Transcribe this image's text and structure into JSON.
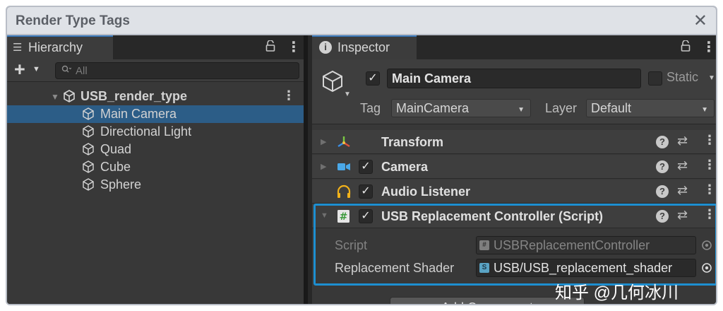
{
  "window": {
    "title": "Render Type Tags",
    "close_glyph": "✕"
  },
  "hierarchy": {
    "tab_label": "Hierarchy",
    "add_label": "+",
    "search_placeholder": "All",
    "scene": {
      "name": "USB_render_type"
    },
    "items": [
      {
        "label": "Main Camera",
        "selected": true
      },
      {
        "label": "Directional Light",
        "selected": false
      },
      {
        "label": "Quad",
        "selected": false
      },
      {
        "label": "Cube",
        "selected": false
      },
      {
        "label": "Sphere",
        "selected": false
      }
    ]
  },
  "inspector": {
    "tab_label": "Inspector",
    "gameobject": {
      "active": true,
      "name": "Main Camera",
      "static_label": "Static",
      "static": false,
      "tag_label": "Tag",
      "tag_value": "MainCamera",
      "layer_label": "Layer",
      "layer_value": "Default"
    },
    "components": [
      {
        "name": "Transform",
        "icon": "transform-icon",
        "has_checkbox": false
      },
      {
        "name": "Camera",
        "icon": "camera-icon",
        "has_checkbox": true,
        "enabled": true
      },
      {
        "name": "Audio Listener",
        "icon": "headphones-icon",
        "has_checkbox": true,
        "enabled": true
      },
      {
        "name": "USB Replacement Controller (Script)",
        "icon": "script-icon",
        "has_checkbox": true,
        "enabled": true,
        "expanded": true
      }
    ],
    "script_props": {
      "script_label": "Script",
      "script_value": "USBReplacementController",
      "shader_label": "Replacement Shader",
      "shader_value": "USB/USB_replacement_shader"
    },
    "add_component_label": "Add Component"
  },
  "watermark": "知乎 @几何冰川",
  "colors": {
    "selection": "#2c5d87",
    "highlight_border": "#1d8fd1",
    "tab_accent": "#3a79bb",
    "panel_bg": "#383838"
  }
}
